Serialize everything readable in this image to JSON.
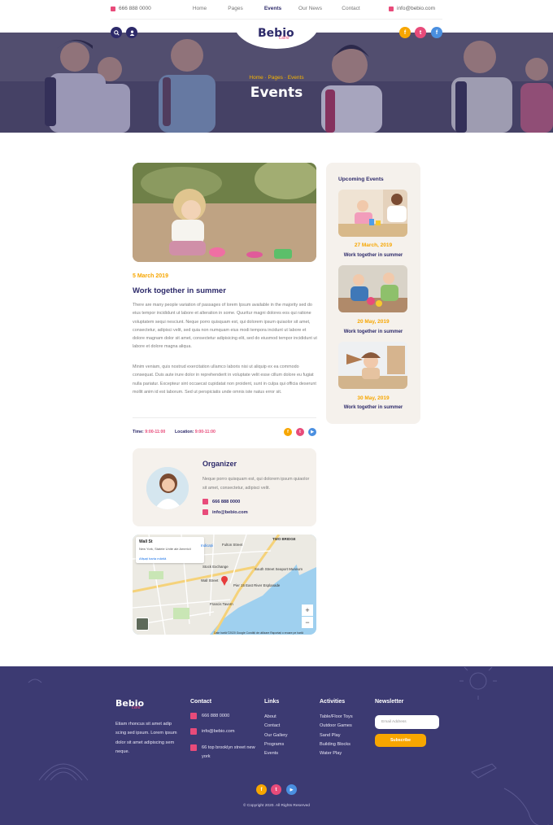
{
  "header": {
    "phone": "666 888 0000",
    "email": "info@bebio.com",
    "nav": [
      "Home",
      "Pages",
      "Events",
      "Our News",
      "Contact"
    ],
    "active_nav": "Events",
    "logo": "Bebio",
    "logo_sub": "care"
  },
  "hero": {
    "breadcrumb": "Home · Pages · Events",
    "title": "Events"
  },
  "article": {
    "date": "5 March 2019",
    "title": "Work together in summer",
    "paragraph1": "There are many people variation of passages of lorem Ipsum available in the majority sed do eius tempor incididunt ut labore et alteration in some. Quuritur magni dolores eos qui ratione voluptatem sequi nesciunt. Neque porro quisquam est, qui dolorem ipsum quiaolor sit amet, consectetur, adipisci velit, sed quia non numquam eius modi tempora incidunt ut labore et dolore magnam dolor sit amet, consectetur adipisicing elit, sed do eiusmod tempor incididunt ut labore et dolore magna aliqua.",
    "paragraph2": "Minim veniam, quis nostrud exercitation ullamco laboris nisi ut aliquip ex ea commodo consequat. Duis aute irure dolor in reprehenderit in voluptate velit esse cillum dolore eu fugiat nulla pariatur. Excepteur sint occaecat cupidatat non proident, sunt in culpa qui officia deserunt mollit anim id est laborum. Sed ut perspiciatis unde omnis iste natus error sit.",
    "time_label": "Time:",
    "time_value": "9:00-11:00",
    "location_label": "Location:",
    "location_value": "9:00-11:00"
  },
  "organizer": {
    "title": "Organizer",
    "text": "Neque porro quisquam est, qui dolorem ipsum quiaolor sit amet, consectetur, adipisci velit.",
    "phone": "666 888 0000",
    "email": "info@bebio.com"
  },
  "map": {
    "place": "Wall St",
    "address": "New York, Statele Unite ale Americii",
    "link": "Afișați harta mărită",
    "directions": "Indicații",
    "labels": [
      "Stock Exchange",
      "South Street Seaport Museum",
      "Wall Street",
      "Pier 15 East River Esplanade",
      "Francis Tavern",
      "Fulton Street",
      "TWO BRIDGE",
      "CENTER"
    ],
    "footer_note": "Date hartă ©2020 Google   Condiții de utilizare   Raportați o eroare pe hartă"
  },
  "sidebar": {
    "title": "Upcoming Events",
    "events": [
      {
        "date": "27 March, 2019",
        "title": "Work together in summer"
      },
      {
        "date": "20 May, 2019",
        "title": "Work together in summer"
      },
      {
        "date": "30 May, 2019",
        "title": "Work together in summer"
      }
    ]
  },
  "footer": {
    "logo": "Bebio",
    "logo_sub": "care",
    "about": "Etiam rhoncus sit amet adip scing sed ipsum. Lorem ipsum dolor sit amet adipiscing sem neque.",
    "contact_title": "Contact",
    "contact_phone": "666 888 0000",
    "contact_email": "info@bebio.com",
    "contact_address": "66 top brooklyn street new york",
    "links_title": "Links",
    "links": [
      "About",
      "Contact",
      "Our Gallery",
      "Programs",
      "Events"
    ],
    "activities_title": "Activities",
    "activities": [
      "Table/Floor Toys",
      "Outdoor Games",
      "Sand Play",
      "Building Blocks",
      "Water Play"
    ],
    "newsletter_title": "Newsletter",
    "email_placeholder": "Email Address",
    "subscribe": "Subscribe",
    "copyright": "© Copyright 2020. All Rights Reserved"
  },
  "colors": {
    "navy": "#2d2a6a",
    "pink": "#e84b7a",
    "orange": "#f7a600",
    "footer_bg": "#3c3a72",
    "card_bg": "#f5f1ec"
  },
  "icons": [
    "phone-icon",
    "mail-icon",
    "search-icon",
    "user-icon",
    "facebook-icon",
    "twitter-icon",
    "youtube-icon",
    "location-icon"
  ]
}
